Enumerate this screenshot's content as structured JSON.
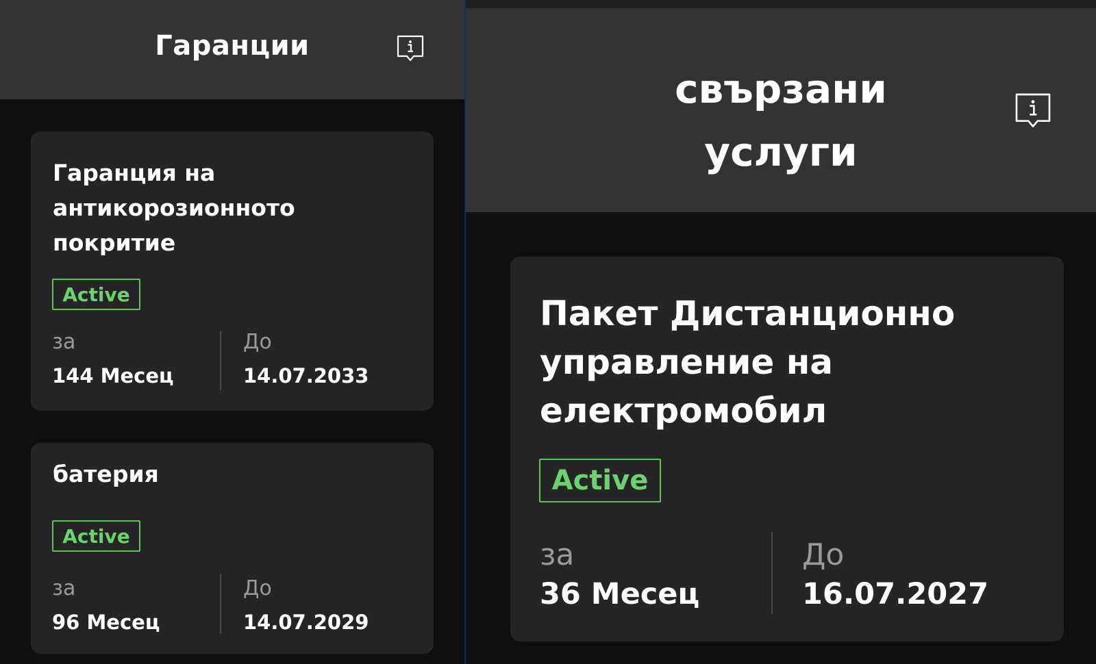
{
  "left": {
    "header": {
      "title": "Гаранции",
      "info_icon": "info-speech-bubble-icon"
    },
    "cards": [
      {
        "title": "Гаранция на антикорозионното покритие",
        "status": "Active",
        "duration_label": "за",
        "duration_value": "144 Месец",
        "until_label": "До",
        "until_value": "14.07.2033"
      },
      {
        "title": "батерия",
        "status": "Active",
        "duration_label": "за",
        "duration_value": "96 Месец",
        "until_label": "До",
        "until_value": "14.07.2029"
      }
    ]
  },
  "right": {
    "header": {
      "title_line1": "свързани",
      "title_line2": "услуги",
      "info_icon": "info-speech-bubble-icon"
    },
    "cards": [
      {
        "title": "Пакет Дистанционно управление на електромобил",
        "status": "Active",
        "duration_label": "за",
        "duration_value": "36 Месец",
        "until_label": "До",
        "until_value": "16.07.2027"
      }
    ]
  },
  "colors": {
    "header_bg": "#333333",
    "card_bg": "#252525",
    "page_bg": "#0f0f0f",
    "status_active": "#6bd36b"
  }
}
